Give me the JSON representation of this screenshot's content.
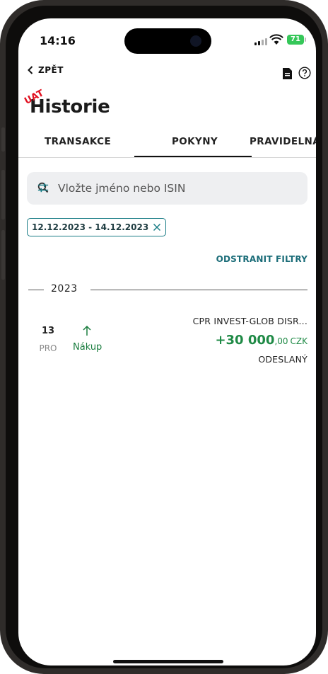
{
  "status_bar": {
    "time": "14:16",
    "battery": "71"
  },
  "header": {
    "back_label": "ZPĚT",
    "title": "Historie",
    "uat_badge": "UAT"
  },
  "tabs": [
    {
      "label": "TRANSAKCE",
      "active": false
    },
    {
      "label": "POKYNY",
      "active": true
    },
    {
      "label": "PRAVIDELNÁ",
      "active": false
    }
  ],
  "search": {
    "placeholder": "Vložte jméno nebo ISIN"
  },
  "filter_chip": {
    "label": "12.12.2023 - 14.12.2023"
  },
  "remove_filters_label": "ODSTRANIT FILTRY",
  "year": "2023",
  "transactions": [
    {
      "day": "13",
      "month": "PRO",
      "direction": "Nákup",
      "fund": "CPR INVEST-GLOB DISR...",
      "amount_main": "+30 000",
      "amount_decimal": ",00",
      "currency": "CZK",
      "status": "ODESLANÝ"
    }
  ],
  "colors": {
    "accent": "#1a7d86",
    "positive": "#1f8a46",
    "uat": "#e10f1f"
  }
}
